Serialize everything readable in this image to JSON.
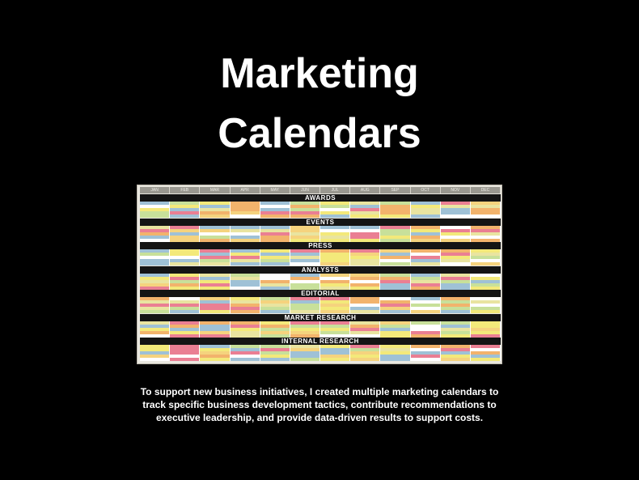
{
  "title": {
    "line1": "Marketing",
    "line2": "Calendars"
  },
  "calendar": {
    "months": [
      "JAN",
      "FEB",
      "MAR",
      "APR",
      "MAY",
      "JUN",
      "JUL",
      "AUG",
      "SEP",
      "OCT",
      "NOV",
      "DEC"
    ],
    "sections": [
      "AWARDS",
      "EVENTS",
      "PRESS",
      "ANALYSTS",
      "EDITORIAL",
      "MARKET RESEARCH",
      "INTERNAL RESEARCH"
    ],
    "cell_colors": [
      "#f3e97a",
      "#f2b36c",
      "#ea7f93",
      "#9fc1d6",
      "#c8e09a",
      "#ffffff",
      "#f5d37e",
      "#e9e4a0"
    ]
  },
  "caption": {
    "line1": "To support new business initiatives, I created multiple marketing calendars to",
    "line2": "track specific business development tactics, contribute recommendations to",
    "line3": "executive leadership, and provide data-driven results to support costs."
  }
}
